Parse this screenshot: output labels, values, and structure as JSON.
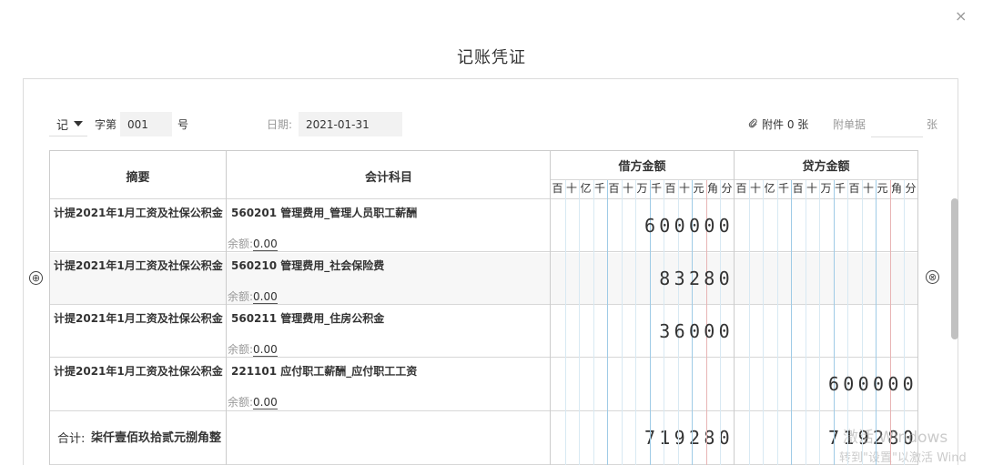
{
  "window": {
    "close_glyph": "×",
    "title": "记账凭证"
  },
  "header": {
    "voucher_type": "记",
    "prefix_label": "字第",
    "voucher_no": "001",
    "suffix_label": "号",
    "date_label": "日期:",
    "date_value": "2021-01-31",
    "attachment_label": "附件 0 张",
    "attached_docs_label": "附单据",
    "attached_docs_value": "",
    "attached_docs_unit": "张"
  },
  "table": {
    "col_summary": "摘要",
    "col_subject": "会计科目",
    "col_debit": "借方金额",
    "col_credit": "贷方金额",
    "digit_labels": [
      "百",
      "十",
      "亿",
      "千",
      "百",
      "十",
      "万",
      "千",
      "百",
      "十",
      "元",
      "角",
      "分"
    ],
    "balance_label": "余额:",
    "rows": [
      {
        "summary": "计提2021年1月工资及社保公积金",
        "subject": "560201 管理费用_管理人员职工薪酬",
        "balance": "0.00",
        "debit": "600000",
        "credit": ""
      },
      {
        "summary": "计提2021年1月工资及社保公积金",
        "subject": "560210 管理费用_社会保险费",
        "balance": "0.00",
        "debit": "83280",
        "credit": ""
      },
      {
        "summary": "计提2021年1月工资及社保公积金",
        "subject": "560211 管理费用_住房公积金",
        "balance": "0.00",
        "debit": "36000",
        "credit": ""
      },
      {
        "summary": "计提2021年1月工资及社保公积金",
        "subject": "221101 应付职工薪酬_应付职工工资",
        "balance": "0.00",
        "debit": "",
        "credit": "600000"
      }
    ],
    "total_label": "合计:",
    "total_text": "柒仟壹佰玖拾贰元捌角整",
    "total_debit": "719280",
    "total_credit": "719280"
  },
  "icons": {
    "add_row": "⊕",
    "delete_row": "⊗",
    "attachment": "paperclip-icon",
    "dropdown": "caret-down-icon"
  },
  "watermark": {
    "line1": "激活 Windows",
    "line2": "转到\"设置\"以激活 Wind"
  },
  "colors": {
    "grid_blue": "#bcdcef",
    "grid_red": "#e8b4b4",
    "zebra": "#f7f7f7"
  }
}
